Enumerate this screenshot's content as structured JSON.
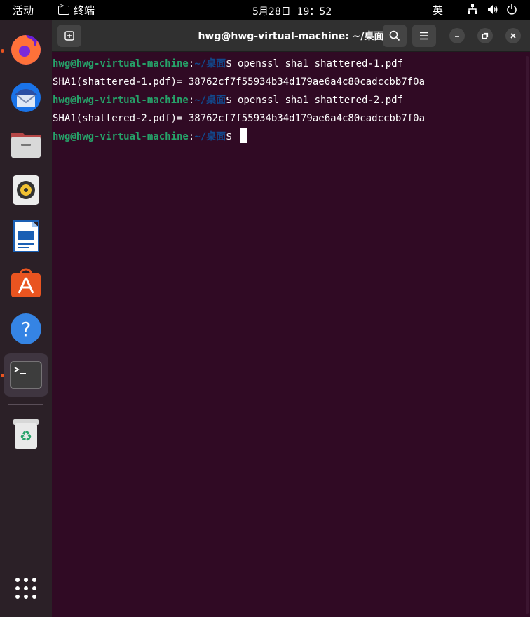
{
  "topbar": {
    "activities": "活动",
    "app_name": "终端",
    "clock": "5月28日  19：52",
    "input_method": "英"
  },
  "dock": {
    "items": [
      {
        "name": "Firefox",
        "icon": "firefox-icon",
        "running": true
      },
      {
        "name": "Thunderbird",
        "icon": "thunderbird-icon",
        "running": false
      },
      {
        "name": "Files",
        "icon": "files-icon",
        "running": false
      },
      {
        "name": "Rhythmbox",
        "icon": "rhythmbox-icon",
        "running": false
      },
      {
        "name": "LibreOffice Writer",
        "icon": "writer-icon",
        "running": false
      },
      {
        "name": "Ubuntu Software",
        "icon": "software-icon",
        "running": false
      },
      {
        "name": "Help",
        "icon": "help-icon",
        "running": false
      },
      {
        "name": "Terminal",
        "icon": "terminal-icon",
        "running": true,
        "active": true
      },
      {
        "name": "Trash",
        "icon": "trash-icon",
        "running": false
      },
      {
        "name": "Show Applications",
        "icon": "app-grid-icon",
        "running": false
      }
    ]
  },
  "window": {
    "title": "hwg@hwg-virtual-machine: ~/桌面"
  },
  "terminal": {
    "lines": [
      {
        "user": "hwg@hwg-virtual-machine",
        "sep": ":",
        "path": "~/桌面",
        "cmd": "$ openssl sha1 shattered-1.pdf"
      },
      {
        "output": "SHA1(shattered-1.pdf)= 38762cf7f55934b34d179ae6a4c80cadccbb7f0a"
      },
      {
        "user": "hwg@hwg-virtual-machine",
        "sep": ":",
        "path": "~/桌面",
        "cmd": "$ openssl sha1 shattered-2.pdf"
      },
      {
        "output": "SHA1(shattered-2.pdf)= 38762cf7f55934b34d179ae6a4c80cadccbb7f0a"
      },
      {
        "user": "hwg@hwg-virtual-machine",
        "sep": ":",
        "path": "~/桌面",
        "cmd": "$ "
      }
    ]
  },
  "colors": {
    "terminal_bg": "#300a24",
    "prompt_user": "#26a269",
    "prompt_path": "#12488b",
    "accent": "#e95420"
  }
}
